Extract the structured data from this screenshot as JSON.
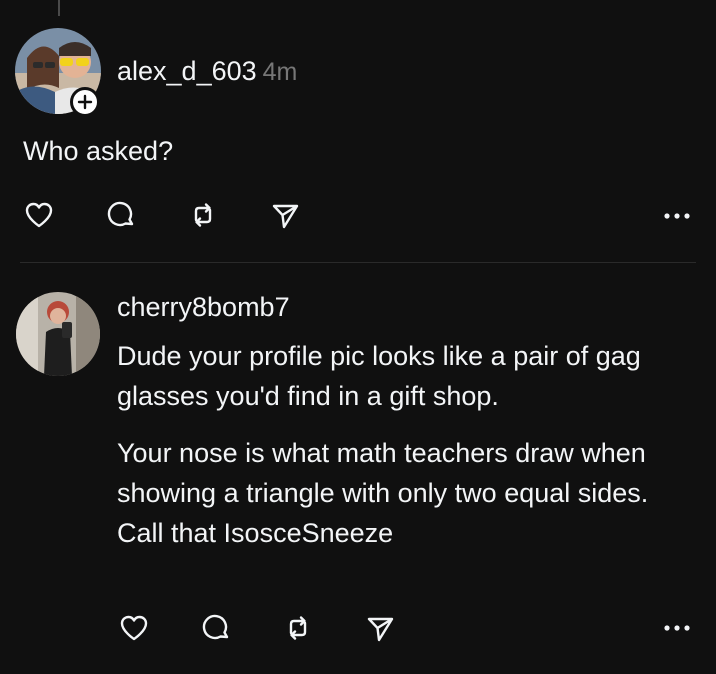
{
  "post1": {
    "username": "alex_d_603",
    "timestamp": "4m",
    "text": "Who asked?",
    "follow_badge_symbol": "+",
    "icons": [
      "heart-icon",
      "comment-icon",
      "repost-icon",
      "share-icon",
      "more-icon"
    ]
  },
  "post2": {
    "username": "cherry8bomb7",
    "paragraphs": [
      "Dude your profile pic looks like a pair of gag glasses you'd find in a gift shop.",
      "Your nose is what math teachers draw when showing a triangle with only two equal sides. Call that IsosceSneeze"
    ],
    "icons": [
      "heart-icon",
      "comment-icon",
      "repost-icon",
      "share-icon",
      "more-icon"
    ]
  },
  "colors": {
    "background": "#101010",
    "text": "#f3f5f7",
    "muted": "#777777",
    "divider": "#2a2a2a"
  }
}
